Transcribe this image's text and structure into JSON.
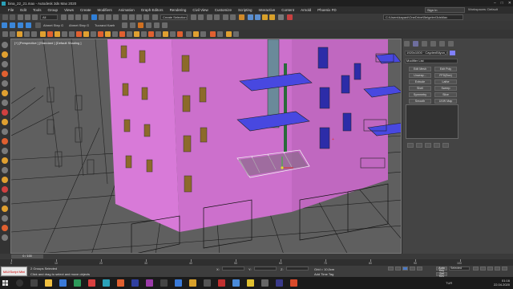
{
  "window": {
    "title": "bina_22_21.max - Autodesk 3ds Max 2020",
    "controls": [
      "–",
      "□",
      "✕"
    ]
  },
  "menu": {
    "items": [
      "File",
      "Edit",
      "Tools",
      "Group",
      "Views",
      "Create",
      "Modifiers",
      "Animation",
      "Graph Editors",
      "Rendering",
      "Civil View",
      "Customize",
      "Scripting",
      "Interactive",
      "Content",
      "Arnold",
      "Phoenix FD"
    ],
    "sign_in": "Sign In",
    "workspaces_label": "Workspaces:",
    "workspace_value": "Default"
  },
  "toolbar1": {
    "filter_value": "All",
    "selection_set": "Create Selection Se",
    "project_path": "C:\\Users\\kayani\\OneDrive\\Belgeler\\3dsMax"
  },
  "toolbar2": {
    "view_combo": "View",
    "sets_label_1": "Ahmet Step G",
    "sets_label_2": "Ahmet Step G",
    "sets_label_3": "Tuorand Kaeh"
  },
  "viewport": {
    "label": "[+] [Perspective ] [Standard ] [Default Shading ]"
  },
  "command_panel": {
    "object_name": "1920x1000 · CaydenBilyon_000 13,27",
    "modifier_list": "Modifier List",
    "buttons": [
      "Edit Mesh",
      "Edit Poly",
      "Unwrap...",
      "FFD(Box)",
      "Extrude",
      "Lathe",
      "Shell",
      "Sweep",
      "Symmetry",
      "Slice",
      "Smooth",
      "UVW Map"
    ],
    "object_color": "#8080ff"
  },
  "timeline": {
    "frame_display": "0 / 100",
    "ticks": [
      "0",
      "10",
      "20",
      "30",
      "40",
      "50",
      "60",
      "70",
      "80",
      "90",
      "100"
    ]
  },
  "statusbar": {
    "maxscript_label": "MAXScript Mini",
    "selection_status": "2 Groups Selected",
    "prompt": "Click and drag to select and move objects",
    "x_label": "X:",
    "y_label": "Y:",
    "z_label": "Z:",
    "grid": "Grid = 10,0cm",
    "add_time_tag": "Add Time Tag",
    "auto_key": "Auto Key",
    "set_key": "Set Key",
    "selected": "Selected"
  },
  "taskbar": {
    "search_placeholder": "",
    "clock_time": "01:16",
    "clock_date": "22.04.2020",
    "lang": "TUR"
  }
}
